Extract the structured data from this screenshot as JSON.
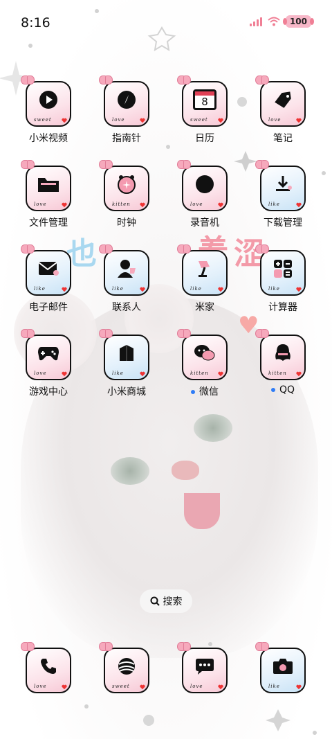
{
  "status_bar": {
    "time": "8:16",
    "battery": "100",
    "accent_color": "#f07f95"
  },
  "apps": [
    {
      "label": "小米视频",
      "script": "sweet",
      "icon": "play-icon",
      "tile": "pink"
    },
    {
      "label": "指南针",
      "script": "love",
      "icon": "compass-icon",
      "tile": "pink"
    },
    {
      "label": "日历",
      "script": "sweet",
      "icon": "calendar-icon",
      "tile": "pink",
      "icon_text": "8"
    },
    {
      "label": "笔记",
      "script": "love",
      "icon": "note-icon",
      "tile": "pink"
    },
    {
      "label": "文件管理",
      "script": "love",
      "icon": "folder-icon",
      "tile": "pink"
    },
    {
      "label": "时钟",
      "script": "kitten",
      "icon": "clock-icon",
      "tile": "pink"
    },
    {
      "label": "录音机",
      "script": "love",
      "icon": "recorder-icon",
      "tile": "pink"
    },
    {
      "label": "下载管理",
      "script": "like",
      "icon": "download-icon",
      "tile": "blue"
    },
    {
      "label": "电子邮件",
      "script": "like",
      "icon": "mail-icon",
      "tile": "blue"
    },
    {
      "label": "联系人",
      "script": "like",
      "icon": "contacts-icon",
      "tile": "blue"
    },
    {
      "label": "米家",
      "script": "like",
      "icon": "lamp-icon",
      "tile": "blue"
    },
    {
      "label": "计算器",
      "script": "like",
      "icon": "calculator-icon",
      "tile": "blue"
    },
    {
      "label": "游戏中心",
      "script": "love",
      "icon": "gamepad-icon",
      "tile": "pink"
    },
    {
      "label": "小米商城",
      "script": "like",
      "icon": "store-icon",
      "tile": "blue"
    },
    {
      "label": "微信",
      "script": "kitten",
      "icon": "wechat-icon",
      "tile": "pink",
      "notification": true
    },
    {
      "label": "QQ",
      "script": "kitten",
      "icon": "qq-icon",
      "tile": "pink",
      "notification": true
    }
  ],
  "search": {
    "label": "搜索",
    "icon": "search-icon"
  },
  "dock": [
    {
      "name": "phone",
      "script": "love",
      "icon": "phone-icon",
      "tile": "pink"
    },
    {
      "name": "browser",
      "script": "sweet",
      "icon": "browser-icon",
      "tile": "pink"
    },
    {
      "name": "messages",
      "script": "love",
      "icon": "message-icon",
      "tile": "pink"
    },
    {
      "name": "camera",
      "script": "like",
      "icon": "camera-icon",
      "tile": "blue"
    }
  ]
}
